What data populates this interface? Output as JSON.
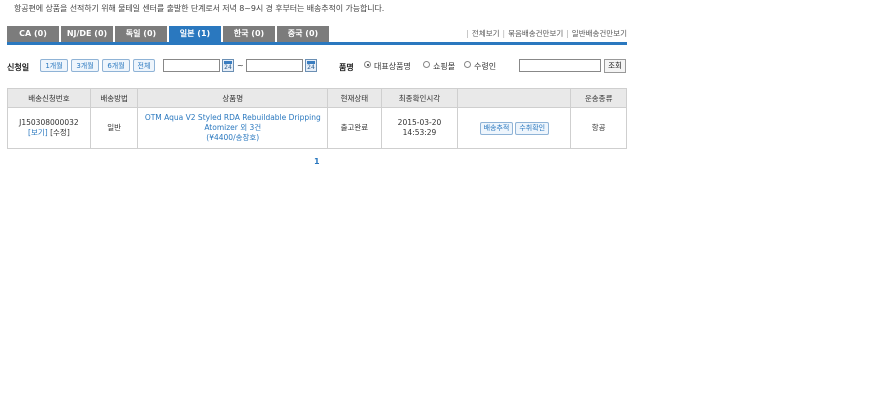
{
  "notice": "항공편에 상품을 선적하기 위해 물테일 센터를 출발한 단계로서 저녁 8~9시 경 후부터는 배송추적이 가능합니다.",
  "tabs": [
    {
      "label": "CA (0)",
      "active": false
    },
    {
      "label": "NJ/DE (0)",
      "active": false
    },
    {
      "label": "독일 (0)",
      "active": false
    },
    {
      "label": "일본 (1)",
      "active": true
    },
    {
      "label": "한국 (0)",
      "active": false
    },
    {
      "label": "중국 (0)",
      "active": false
    }
  ],
  "views": {
    "all": "전체보기",
    "bundle": "묶음배송건만보기",
    "normal": "일반배송건만보기"
  },
  "filter": {
    "date_label": "신청일",
    "periods": [
      "1개월",
      "3개월",
      "6개월",
      "전체"
    ],
    "date_from": "",
    "date_to": "",
    "tilde": "~",
    "calendar_icon": "24",
    "product_label": "품명",
    "radio_options": [
      "대표상품명",
      "쇼핑몰",
      "수령인"
    ],
    "selected_radio": "대표상품명",
    "search_value": "",
    "search_button": "조회"
  },
  "table": {
    "headers": [
      "배송신청번호",
      "배송방법",
      "상품명",
      "현재상태",
      "최종확인시각",
      "",
      "운송종류"
    ],
    "rows": [
      {
        "order_no": "J150308000032",
        "view_link": "[보기]",
        "edit_link": "[수정]",
        "method": "일반",
        "product_name": "OTM Aqua V2 Styled RDA Rebuildable Dripping Atomizer 외 3건",
        "product_price": "(¥4400/송장호)",
        "status": "출고완료",
        "confirm_date": "2015-03-20",
        "confirm_time": "14:53:29",
        "track_button": "배송추적",
        "receipt_button": "수취확인",
        "transport": "항공"
      }
    ]
  },
  "pagination": {
    "current": "1"
  }
}
